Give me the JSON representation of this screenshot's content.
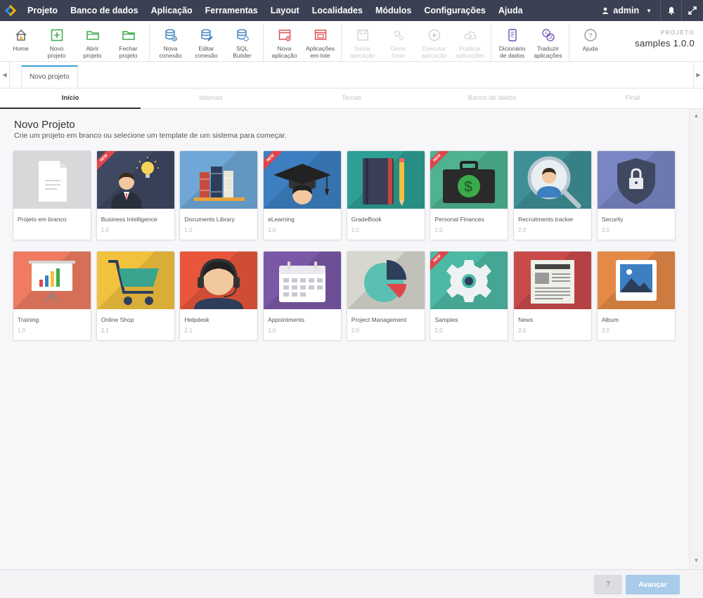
{
  "menu": [
    "Projeto",
    "Banco de dados",
    "Aplicação",
    "Ferramentas",
    "Layout",
    "Localidades",
    "Módulos",
    "Configurações",
    "Ajuda"
  ],
  "user": {
    "name": "admin"
  },
  "toolbar": {
    "groups": [
      [
        {
          "label": "Home",
          "icon": "home-icon",
          "disabled": false
        },
        {
          "label": "Novo\nprojeto",
          "icon": "plus-square-icon",
          "disabled": false
        },
        {
          "label": "Abrir\nprojeto",
          "icon": "folder-open-icon",
          "disabled": false
        },
        {
          "label": "Fechar\nprojeto",
          "icon": "folder-close-icon",
          "disabled": false
        }
      ],
      [
        {
          "label": "Nova\nconexão",
          "icon": "database-add-icon",
          "disabled": false
        },
        {
          "label": "Editar\nconexão",
          "icon": "database-edit-icon",
          "disabled": false
        },
        {
          "label": "SQL\nBuilder",
          "icon": "database-gear-icon",
          "disabled": false
        }
      ],
      [
        {
          "label": "Nova\naplicação",
          "icon": "window-add-icon",
          "disabled": false
        },
        {
          "label": "Aplicações\nem lote",
          "icon": "windows-batch-icon",
          "disabled": false
        }
      ],
      [
        {
          "label": "Salvar\naplicação",
          "icon": "save-icon",
          "disabled": true
        },
        {
          "label": "Gerar\nfonte",
          "icon": "gears-icon",
          "disabled": true
        },
        {
          "label": "Executar\naplicação",
          "icon": "play-icon",
          "disabled": true
        },
        {
          "label": "Publicar\naplicações",
          "icon": "cloud-upload-icon",
          "disabled": true
        }
      ],
      [
        {
          "label": "Dicionário\nde dados",
          "icon": "dictionary-icon",
          "disabled": false
        },
        {
          "label": "Traduzir\naplicações",
          "icon": "translate-icon",
          "disabled": false
        }
      ],
      [
        {
          "label": "Ajuda",
          "icon": "help-icon",
          "disabled": false
        }
      ]
    ]
  },
  "project": {
    "label": "PROJETO",
    "name": "samples 1.0.0"
  },
  "doc_tab": "Novo projeto",
  "steps": [
    "Início",
    "Idiomas",
    "Temas",
    "Banco de dados",
    "Final"
  ],
  "active_step": 0,
  "content": {
    "title": "Novo Projeto",
    "subtitle": "Crie um projeto em branco ou selecione um template de um sistema para começar."
  },
  "new_badge": "NEW",
  "templates": [
    {
      "name": "Projeto em branco",
      "version": "",
      "bg": "#d8d8da",
      "icon": "blank-document-icon",
      "new": false
    },
    {
      "name": "Business Intelligence",
      "version": "1.0",
      "bg": "#3e4860",
      "icon": "businessman-idea-icon",
      "new": true
    },
    {
      "name": "Documents Library",
      "version": "1.0",
      "bg": "#6fa8d6",
      "icon": "books-icon",
      "new": false
    },
    {
      "name": "eLearning",
      "version": "1.0",
      "bg": "#3d7fc1",
      "icon": "graduation-cap-icon",
      "new": true
    },
    {
      "name": "GradeBook",
      "version": "1.0",
      "bg": "#2d9f94",
      "icon": "notebook-pencil-icon",
      "new": false
    },
    {
      "name": "Personal Finances",
      "version": "1.0",
      "bg": "#4fb392",
      "icon": "money-briefcase-icon",
      "new": true
    },
    {
      "name": "Recruitments tracker",
      "version": "2.0",
      "bg": "#3e8f96",
      "icon": "magnifier-person-icon",
      "new": false
    },
    {
      "name": "Security",
      "version": "2.0",
      "bg": "#7a86c4",
      "icon": "shield-lock-icon",
      "new": false
    },
    {
      "name": "Training",
      "version": "1.0",
      "bg": "#ef7c62",
      "icon": "presentation-board-icon",
      "new": false
    },
    {
      "name": "Online Shop",
      "version": "2.1",
      "bg": "#f2c13e",
      "icon": "shopping-cart-icon",
      "new": false
    },
    {
      "name": "Helpdesk",
      "version": "2.1",
      "bg": "#e8563c",
      "icon": "headset-agent-icon",
      "new": false
    },
    {
      "name": "Appointments",
      "version": "1.0",
      "bg": "#7a58a8",
      "icon": "calendar-icon",
      "new": false
    },
    {
      "name": "Project Management",
      "version": "2.0",
      "bg": "#d7d7cf",
      "icon": "pie-chart-icon",
      "new": false
    },
    {
      "name": "Samples",
      "version": "2.0",
      "bg": "#4cb9a4",
      "icon": "gear-icon",
      "new": true
    },
    {
      "name": "News",
      "version": "2.0",
      "bg": "#c94a4a",
      "icon": "newspaper-icon",
      "new": false
    },
    {
      "name": "Album",
      "version": "2.0",
      "bg": "#e58a46",
      "icon": "picture-icon",
      "new": false
    }
  ],
  "footer": {
    "help_label": "?",
    "next_label": "Avançar"
  }
}
